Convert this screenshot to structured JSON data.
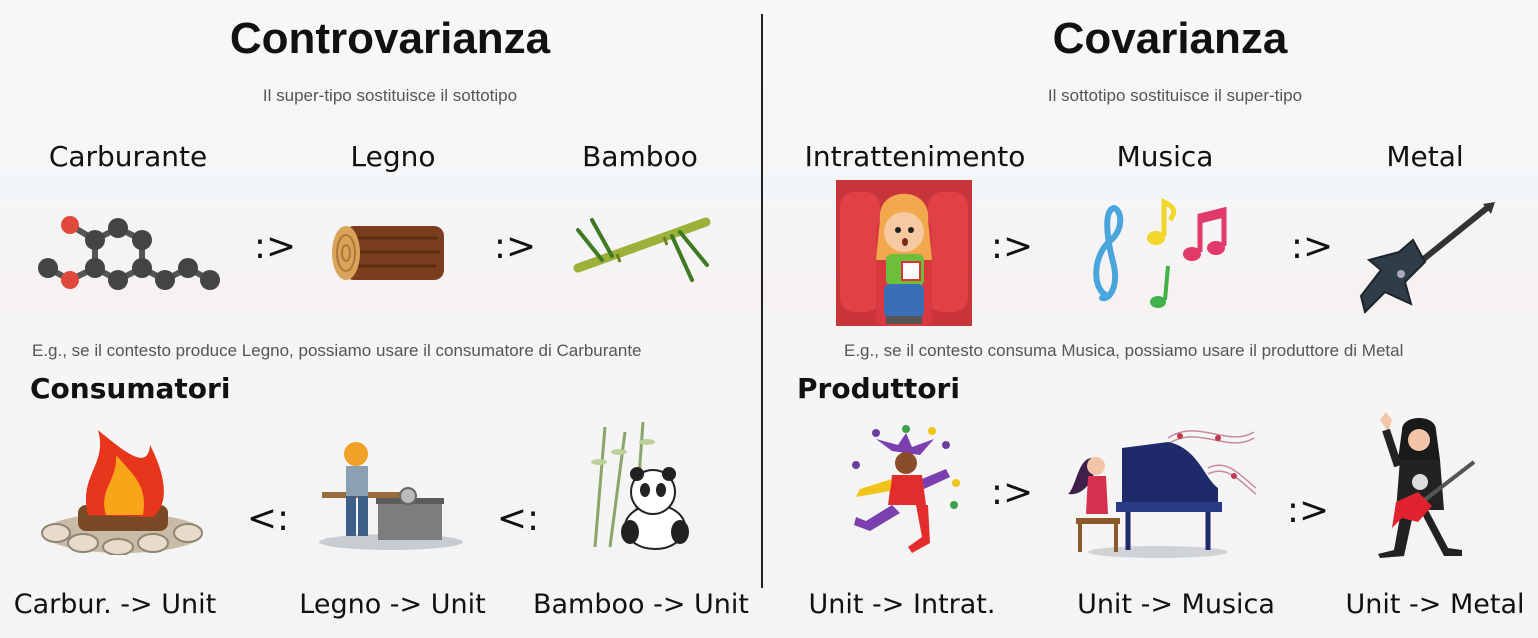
{
  "left": {
    "title": "Controvarianza",
    "subtitle": "Il super-tipo sostituisce il sottotipo",
    "types": [
      "Carburante",
      "Legno",
      "Bamboo"
    ],
    "type_operator": ":>",
    "example": "E.g., se il contesto produce Legno, possiamo usare il consumatore di Carburante",
    "section": "Consumatori",
    "consumer_operator": "<:",
    "functions": [
      "Carbur. -> Unit",
      "Legno -> Unit",
      "Bamboo -> Unit"
    ]
  },
  "right": {
    "title": "Covarianza",
    "subtitle": "Il sottotipo sostituisce il super-tipo",
    "types": [
      "Intrattenimento",
      "Musica",
      "Metal"
    ],
    "type_operator": ":>",
    "example": "E.g., se il contesto consuma Musica, possiamo usare il produttore di Metal",
    "section": "Produttori",
    "producer_operator": ":>",
    "functions": [
      "Unit -> Intrat.",
      "Unit -> Musica",
      "Unit -> Metal"
    ]
  },
  "icons": {
    "left_types": [
      "molecule-icon",
      "log-icon",
      "bamboo-icon"
    ],
    "left_consumers": [
      "campfire-icon",
      "lumberjack-icon",
      "panda-icon"
    ],
    "right_types": [
      "cinema-girl-icon",
      "music-notes-icon",
      "electric-guitar-icon"
    ],
    "right_producers": [
      "jester-icon",
      "pianist-icon",
      "metal-guitarist-icon"
    ]
  }
}
